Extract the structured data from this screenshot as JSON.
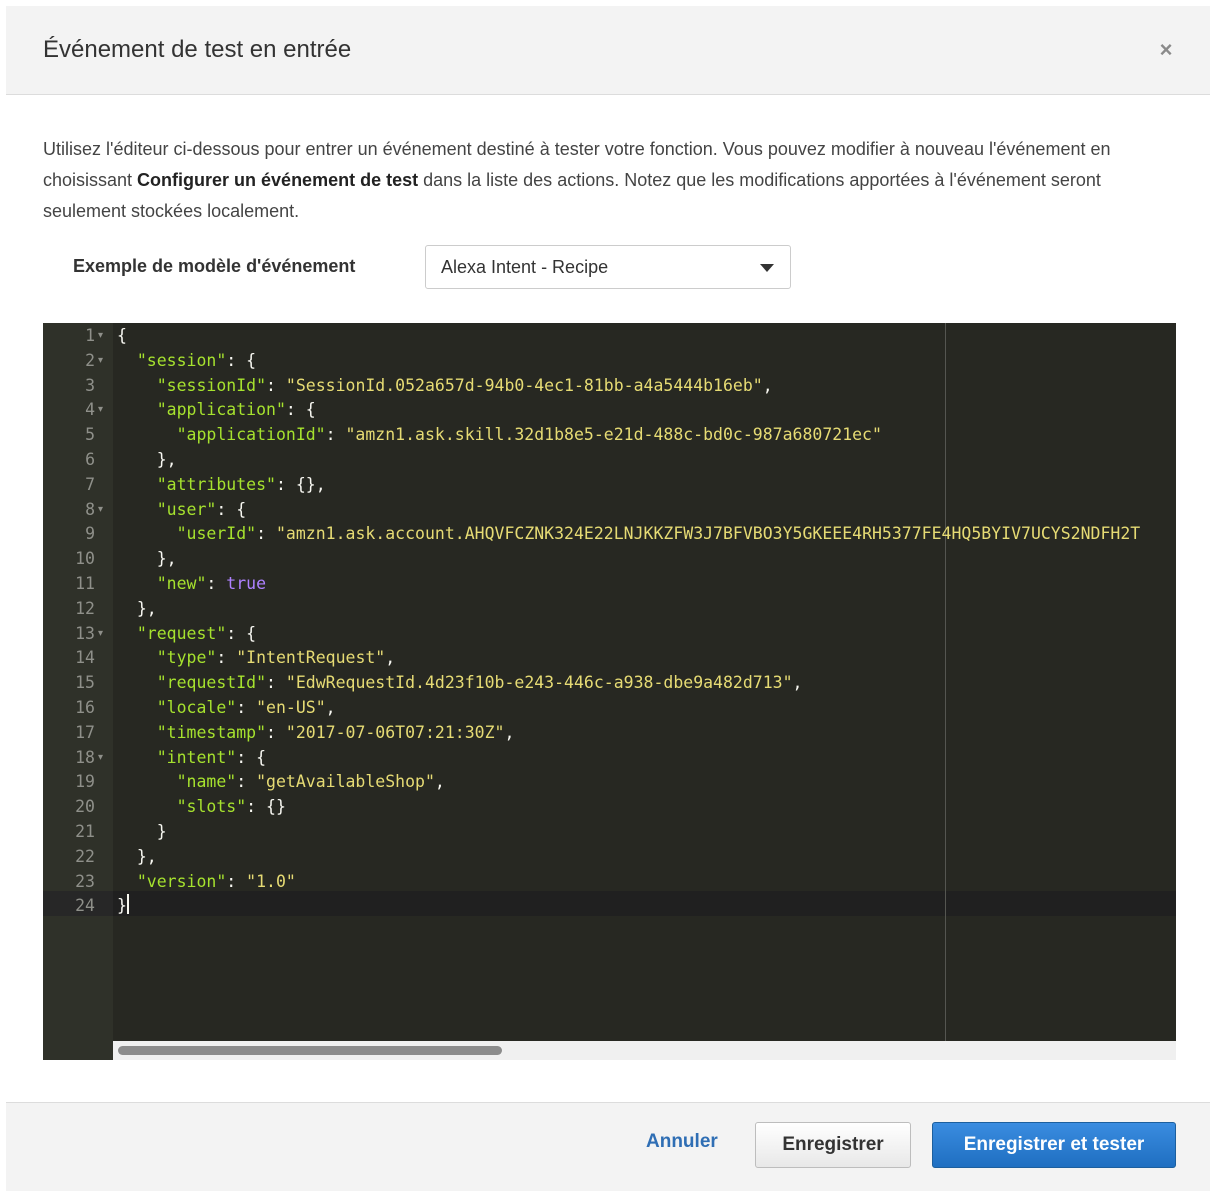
{
  "modal": {
    "title": "Événement de test en entrée",
    "close_glyph": "×",
    "description_part1": "Utilisez l'éditeur ci-dessous pour entrer un événement destiné à tester votre fonction. Vous pouvez modifier à nouveau l'événement en choisissant ",
    "description_bold": "Configurer un événement de test",
    "description_part2": " dans la liste des actions. Notez que les modifications apportées à l'événement seront seulement stockées localement."
  },
  "template": {
    "label": "Exemple de modèle d'événement",
    "selected": "Alexa Intent - Recipe"
  },
  "editor": {
    "theme": "monokai",
    "active_line": 24,
    "lines": [
      {
        "n": "1",
        "fold": true,
        "tokens": [
          [
            "p",
            "{"
          ]
        ]
      },
      {
        "n": "2",
        "fold": true,
        "tokens": [
          [
            "p",
            "  "
          ],
          [
            "k",
            "\"session\""
          ],
          [
            "p",
            ": {"
          ]
        ]
      },
      {
        "n": "3",
        "fold": false,
        "tokens": [
          [
            "p",
            "    "
          ],
          [
            "k",
            "\"sessionId\""
          ],
          [
            "p",
            ": "
          ],
          [
            "s",
            "\"SessionId.052a657d-94b0-4ec1-81bb-a4a5444b16eb\""
          ],
          [
            "p",
            ","
          ]
        ]
      },
      {
        "n": "4",
        "fold": true,
        "tokens": [
          [
            "p",
            "    "
          ],
          [
            "k",
            "\"application\""
          ],
          [
            "p",
            ": {"
          ]
        ]
      },
      {
        "n": "5",
        "fold": false,
        "tokens": [
          [
            "p",
            "      "
          ],
          [
            "k",
            "\"applicationId\""
          ],
          [
            "p",
            ": "
          ],
          [
            "s",
            "\"amzn1.ask.skill.32d1b8e5-e21d-488c-bd0c-987a680721ec\""
          ]
        ]
      },
      {
        "n": "6",
        "fold": false,
        "tokens": [
          [
            "p",
            "    },"
          ]
        ]
      },
      {
        "n": "7",
        "fold": false,
        "tokens": [
          [
            "p",
            "    "
          ],
          [
            "k",
            "\"attributes\""
          ],
          [
            "p",
            ": {},"
          ]
        ]
      },
      {
        "n": "8",
        "fold": true,
        "tokens": [
          [
            "p",
            "    "
          ],
          [
            "k",
            "\"user\""
          ],
          [
            "p",
            ": {"
          ]
        ]
      },
      {
        "n": "9",
        "fold": false,
        "tokens": [
          [
            "p",
            "      "
          ],
          [
            "k",
            "\"userId\""
          ],
          [
            "p",
            ": "
          ],
          [
            "s",
            "\"amzn1.ask.account.AHQVFCZNK324E22LNJKKZFW3J7BFVBO3Y5GKEEE4RH5377FE4HQ5BYIV7UCYS2NDFH2T"
          ]
        ]
      },
      {
        "n": "10",
        "fold": false,
        "tokens": [
          [
            "p",
            "    },"
          ]
        ]
      },
      {
        "n": "11",
        "fold": false,
        "tokens": [
          [
            "p",
            "    "
          ],
          [
            "k",
            "\"new\""
          ],
          [
            "p",
            ": "
          ],
          [
            "c",
            "true"
          ]
        ]
      },
      {
        "n": "12",
        "fold": false,
        "tokens": [
          [
            "p",
            "  },"
          ]
        ]
      },
      {
        "n": "13",
        "fold": true,
        "tokens": [
          [
            "p",
            "  "
          ],
          [
            "k",
            "\"request\""
          ],
          [
            "p",
            ": {"
          ]
        ]
      },
      {
        "n": "14",
        "fold": false,
        "tokens": [
          [
            "p",
            "    "
          ],
          [
            "k",
            "\"type\""
          ],
          [
            "p",
            ": "
          ],
          [
            "s",
            "\"IntentRequest\""
          ],
          [
            "p",
            ","
          ]
        ]
      },
      {
        "n": "15",
        "fold": false,
        "tokens": [
          [
            "p",
            "    "
          ],
          [
            "k",
            "\"requestId\""
          ],
          [
            "p",
            ": "
          ],
          [
            "s",
            "\"EdwRequestId.4d23f10b-e243-446c-a938-dbe9a482d713\""
          ],
          [
            "p",
            ","
          ]
        ]
      },
      {
        "n": "16",
        "fold": false,
        "tokens": [
          [
            "p",
            "    "
          ],
          [
            "k",
            "\"locale\""
          ],
          [
            "p",
            ": "
          ],
          [
            "s",
            "\"en-US\""
          ],
          [
            "p",
            ","
          ]
        ]
      },
      {
        "n": "17",
        "fold": false,
        "tokens": [
          [
            "p",
            "    "
          ],
          [
            "k",
            "\"timestamp\""
          ],
          [
            "p",
            ": "
          ],
          [
            "s",
            "\"2017-07-06T07:21:30Z\""
          ],
          [
            "p",
            ","
          ]
        ]
      },
      {
        "n": "18",
        "fold": true,
        "tokens": [
          [
            "p",
            "    "
          ],
          [
            "k",
            "\"intent\""
          ],
          [
            "p",
            ": {"
          ]
        ]
      },
      {
        "n": "19",
        "fold": false,
        "tokens": [
          [
            "p",
            "      "
          ],
          [
            "k",
            "\"name\""
          ],
          [
            "p",
            ": "
          ],
          [
            "s",
            "\"getAvailableShop\""
          ],
          [
            "p",
            ","
          ]
        ]
      },
      {
        "n": "20",
        "fold": false,
        "tokens": [
          [
            "p",
            "      "
          ],
          [
            "k",
            "\"slots\""
          ],
          [
            "p",
            ": {}"
          ]
        ]
      },
      {
        "n": "21",
        "fold": false,
        "tokens": [
          [
            "p",
            "    }"
          ]
        ]
      },
      {
        "n": "22",
        "fold": false,
        "tokens": [
          [
            "p",
            "  },"
          ]
        ]
      },
      {
        "n": "23",
        "fold": false,
        "tokens": [
          [
            "p",
            "  "
          ],
          [
            "k",
            "\"version\""
          ],
          [
            "p",
            ": "
          ],
          [
            "s",
            "\"1.0\""
          ]
        ]
      },
      {
        "n": "24",
        "fold": false,
        "tokens": [
          [
            "p",
            "}"
          ]
        ]
      }
    ]
  },
  "footer": {
    "cancel_label": "Annuler",
    "save_label": "Enregistrer",
    "save_test_label": "Enregistrer et tester"
  },
  "colors": {
    "primary_button": "#1f6fc1",
    "link": "#2f6eb4",
    "editor_bg": "#272822"
  }
}
